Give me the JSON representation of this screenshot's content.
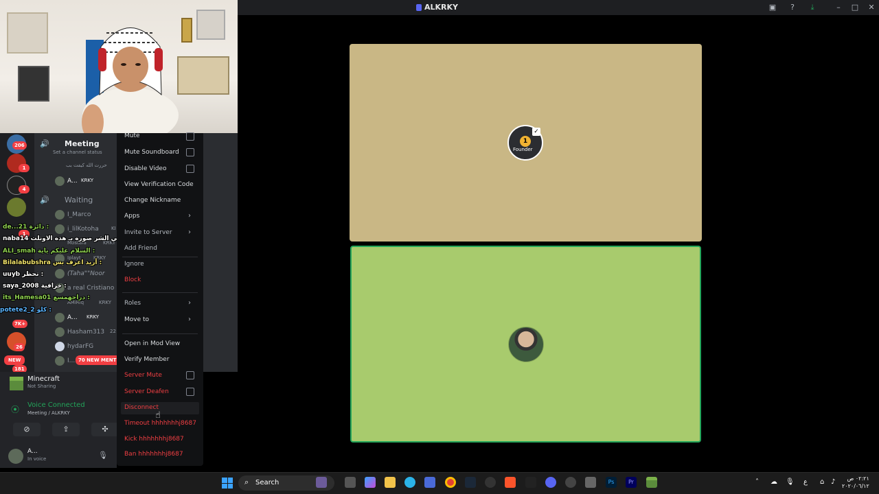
{
  "window": {
    "title": "ALKRKY"
  },
  "tiles": [
    {
      "badge_number": "1",
      "badge_label": "Founder",
      "color": "#c9b785"
    },
    {
      "color": "#a8cb6d",
      "speaking_color": "#23a55a"
    }
  ],
  "channels": {
    "meeting": {
      "name": "Meeting",
      "status_placeholder": "Set a channel status"
    },
    "meeting_topline": "حررت الله كيفت بب",
    "meeting_user": {
      "name": "A...",
      "tag": "KRKY"
    },
    "waiting": {
      "name": "Waiting"
    },
    "waiting_users": [
      {
        "name": "I_Marco"
      },
      {
        "name": "i_lilKotoha",
        "tag": "KI"
      },
      {
        "name": "Mostafa",
        "tag": "KRKY"
      },
      {
        "name": "Iplayt",
        "tag": "KRKY"
      },
      {
        "name": "(Taha\"\"Noor"
      },
      {
        "name": "a real Cristiano"
      },
      {
        "name": "AMiRiq",
        "tag": "KRKY"
      },
      {
        "name": "A...",
        "tag": "KRKY"
      },
      {
        "name": "Hasham313",
        "tag": "22"
      },
      {
        "name": "hydarFG"
      },
      {
        "name": "I..."
      }
    ],
    "new_mentions": "70 NEW MENTIONS"
  },
  "server_badges": [
    "206",
    "1",
    "4",
    "1",
    "7K+",
    "26",
    "181"
  ],
  "new_label": "NEW",
  "chat_overlay": [
    {
      "user": "de...21",
      "text": "دائرة :"
    },
    {
      "user": "naba14",
      "text": "كركي الشر صوره بـ هذه الاونلت :"
    },
    {
      "user": "ALI_smah",
      "text": "السلام عليكم ياية :"
    },
    {
      "user": "Bilalabubshra",
      "text": "أريد اعرف بس :"
    },
    {
      "user": "uuyb",
      "text": "نحظر :"
    },
    {
      "user": "saya_2008",
      "text": "خرافية :"
    },
    {
      "user": "its_Hamesa01",
      "text": "دراجهمسع :"
    },
    {
      "user": "potete2_2",
      "text": "كلو :"
    }
  ],
  "activity": {
    "game": "Minecraft",
    "game_status": "Not Sharing",
    "voice_status": "Voice Connected",
    "voice_path": "Meeting / ALKRKY"
  },
  "user": {
    "name": "A...",
    "status": "In voice"
  },
  "context_menu": {
    "items": [
      {
        "label": "Mute",
        "type": "checkbox"
      },
      {
        "label": "Mute Soundboard",
        "type": "checkbox"
      },
      {
        "label": "Disable Video",
        "type": "checkbox"
      },
      {
        "label": "View Verification Code"
      },
      {
        "label": "Change Nickname"
      },
      {
        "label": "Apps",
        "type": "submenu"
      },
      {
        "label": "Invite to Server",
        "type": "submenu"
      },
      {
        "label": "Add Friend"
      },
      {
        "label": "Ignore"
      },
      {
        "label": "Block",
        "danger": true
      },
      {
        "label": "Roles",
        "type": "submenu"
      },
      {
        "label": "Move to",
        "type": "submenu"
      },
      {
        "label": "Open in Mod View"
      },
      {
        "label": "Verify Member"
      },
      {
        "label": "Server Mute",
        "type": "checkbox",
        "danger": true
      },
      {
        "label": "Server Deafen",
        "type": "checkbox",
        "danger": true
      },
      {
        "label": "Disconnect",
        "danger": true
      },
      {
        "label": "Timeout hhhhhhhj8687",
        "danger": true
      },
      {
        "label": "Kick hhhhhhhj8687",
        "danger": true
      },
      {
        "label": "Ban hhhhhhhj8687",
        "danger": true
      }
    ]
  },
  "taskbar": {
    "search_label": "Search",
    "clock_time": "٠٢:٢١ ص",
    "clock_date": "٢٠٢٠/٠٦/١٢",
    "lang": "ع"
  }
}
